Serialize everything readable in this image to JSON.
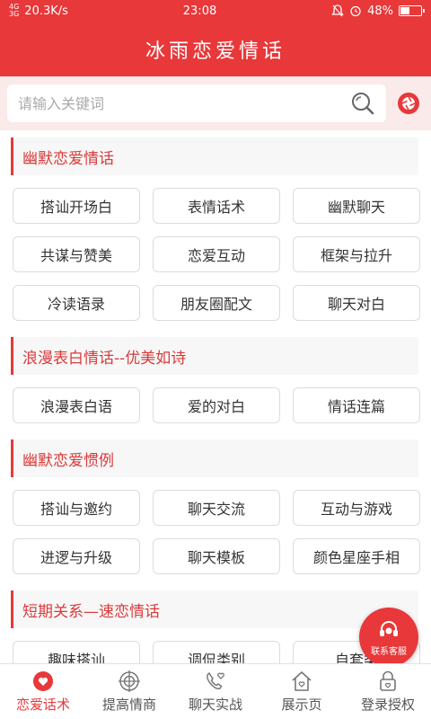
{
  "status_bar": {
    "network_left": "4G",
    "network_right": "3G",
    "speed": "20.3K/s",
    "time": "23:08",
    "battery": "48%",
    "battery_level": 0.48
  },
  "header": {
    "title": "冰雨恋爱情话"
  },
  "search": {
    "placeholder": "请输入关键词"
  },
  "sections": [
    {
      "title": "幽默恋爱情话",
      "items": [
        "搭讪开场白",
        "表情话术",
        "幽默聊天",
        "共谋与赞美",
        "恋爱互动",
        "框架与拉升",
        "冷读语录",
        "朋友圈配文",
        "聊天对白"
      ]
    },
    {
      "title": "浪漫表白情话--优美如诗",
      "items": [
        "浪漫表白语",
        "爱的对白",
        "情话连篇"
      ]
    },
    {
      "title": "幽默恋爱惯例",
      "items": [
        "搭讪与邀约",
        "聊天交流",
        "互动与游戏",
        "进逻与升级",
        "聊天模板",
        "颜色星座手相"
      ]
    },
    {
      "title": "短期关系—速恋情话",
      "items": [
        "趣味搭讪",
        "调侃类别",
        "自套类"
      ]
    }
  ],
  "fab": {
    "label": "联系客服"
  },
  "tabs": [
    {
      "label": "恋爱话术",
      "icon": "heart-chat-icon",
      "active": true
    },
    {
      "label": "提高情商",
      "icon": "target-icon",
      "active": false
    },
    {
      "label": "聊天实战",
      "icon": "phone-heart-icon",
      "active": false
    },
    {
      "label": "展示页",
      "icon": "home-icon",
      "active": false
    },
    {
      "label": "登录授权",
      "icon": "lock-icon",
      "active": false
    }
  ],
  "colors": {
    "primary": "#e8383a",
    "search_bg": "#fbeaea",
    "section_bg": "#f7f7f7"
  }
}
